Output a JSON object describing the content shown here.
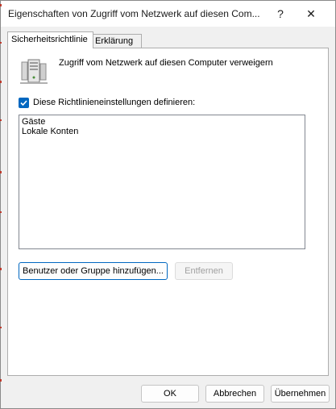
{
  "window": {
    "title": "Eigenschaften von Zugriff vom Netzwerk auf diesen Com...",
    "help_glyph": "?",
    "close_glyph": "✕"
  },
  "tabs": [
    {
      "label": "Sicherheitsrichtlinie",
      "active": true
    },
    {
      "label": "Erklärung",
      "active": false
    }
  ],
  "policy": {
    "icon": "server-icon",
    "title": "Zugriff vom Netzwerk auf diesen Computer verweigern"
  },
  "define_checkbox": {
    "label": "Diese Richtlinieneinstellungen definieren:",
    "checked": true
  },
  "accounts": [
    "Gäste",
    "Lokale Konten"
  ],
  "actions": {
    "add_label": "Benutzer oder Gruppe hinzufügen...",
    "remove_label": "Entfernen"
  },
  "footer": {
    "ok_label": "OK",
    "cancel_label": "Abbrechen",
    "apply_label": "Übernehmen"
  },
  "colors": {
    "accent": "#0067c0",
    "window_bg": "#f0f0f0",
    "panel_bg": "#ffffff"
  }
}
